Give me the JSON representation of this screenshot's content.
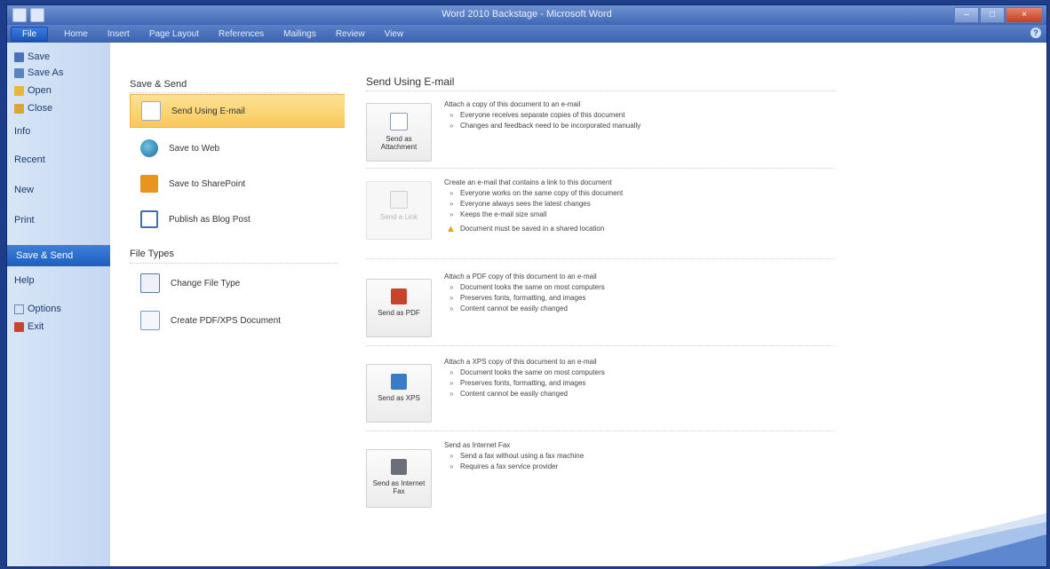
{
  "window": {
    "title": "Word 2010 Backstage - Microsoft Word",
    "controls": {
      "minimize": "–",
      "maximize": "□",
      "close": "×"
    }
  },
  "ribbon": {
    "tabs": [
      "File",
      "Home",
      "Insert",
      "Page Layout",
      "References",
      "Mailings",
      "Review",
      "View"
    ]
  },
  "nav": {
    "save": "Save",
    "save_as": "Save As",
    "open": "Open",
    "close": "Close",
    "info": "Info",
    "recent": "Recent",
    "new": "New",
    "print": "Print",
    "save_send": "Save & Send",
    "help": "Help",
    "options": "Options",
    "exit": "Exit"
  },
  "middle": {
    "save_send_header": "Save & Send",
    "file_types_header": "File Types",
    "items": [
      {
        "label": "Send Using E-mail",
        "icon": "email-icon",
        "color": "#6a8fc7"
      },
      {
        "label": "Save to Web",
        "icon": "globe-icon",
        "color": "#2d7fb3"
      },
      {
        "label": "Save to SharePoint",
        "icon": "sharepoint-icon",
        "color": "#e8941f"
      },
      {
        "label": "Publish as Blog Post",
        "icon": "blog-icon",
        "color": "#3c6fb3"
      }
    ],
    "file_type_items": [
      {
        "label": "Change File Type",
        "icon": "change-file-type-icon",
        "color": "#5d78a8"
      },
      {
        "label": "Create PDF/XPS Document",
        "icon": "pdf-xps-icon",
        "color": "#7a9cc8"
      }
    ]
  },
  "right": {
    "title": "Send Using E-mail",
    "options": [
      {
        "button": "Send as Attachment",
        "icon": "attachment-icon",
        "disabled": false,
        "description": "Attach a copy of this document to an e-mail",
        "bullets": [
          "Everyone receives separate copies of this document",
          "Changes and feedback need to be incorporated manually"
        ],
        "warning": ""
      },
      {
        "button": "Send a Link",
        "icon": "link-icon",
        "disabled": true,
        "description": "Create an e-mail that contains a link to this document",
        "bullets": [
          "Everyone works on the same copy of this document",
          "Everyone always sees the latest changes",
          "Keeps the e-mail size small"
        ],
        "warning": "Document must be saved in a shared location"
      },
      {
        "button": "Send as PDF",
        "icon": "pdf-icon",
        "disabled": false,
        "description": "Attach a PDF copy of this document to an e-mail",
        "bullets": [
          "Document looks the same on most computers",
          "Preserves fonts, formatting, and images",
          "Content cannot be easily changed"
        ],
        "warning": ""
      },
      {
        "button": "Send as XPS",
        "icon": "xps-icon",
        "disabled": false,
        "description": "Attach a XPS copy of this document to an e-mail",
        "bullets": [
          "Document looks the same on most computers",
          "Preserves fonts, formatting, and images",
          "Content cannot be easily changed"
        ],
        "warning": ""
      },
      {
        "button": "Send as Internet Fax",
        "icon": "fax-icon",
        "disabled": false,
        "description": "Send as Internet Fax",
        "bullets": [
          "Send a fax without using a fax machine",
          "Requires a fax service provider"
        ],
        "warning": ""
      }
    ]
  },
  "colors": {
    "accent": "#1e5fbf",
    "selected_item": "#f8c85a",
    "nav_bg": "#c5d8f1"
  }
}
